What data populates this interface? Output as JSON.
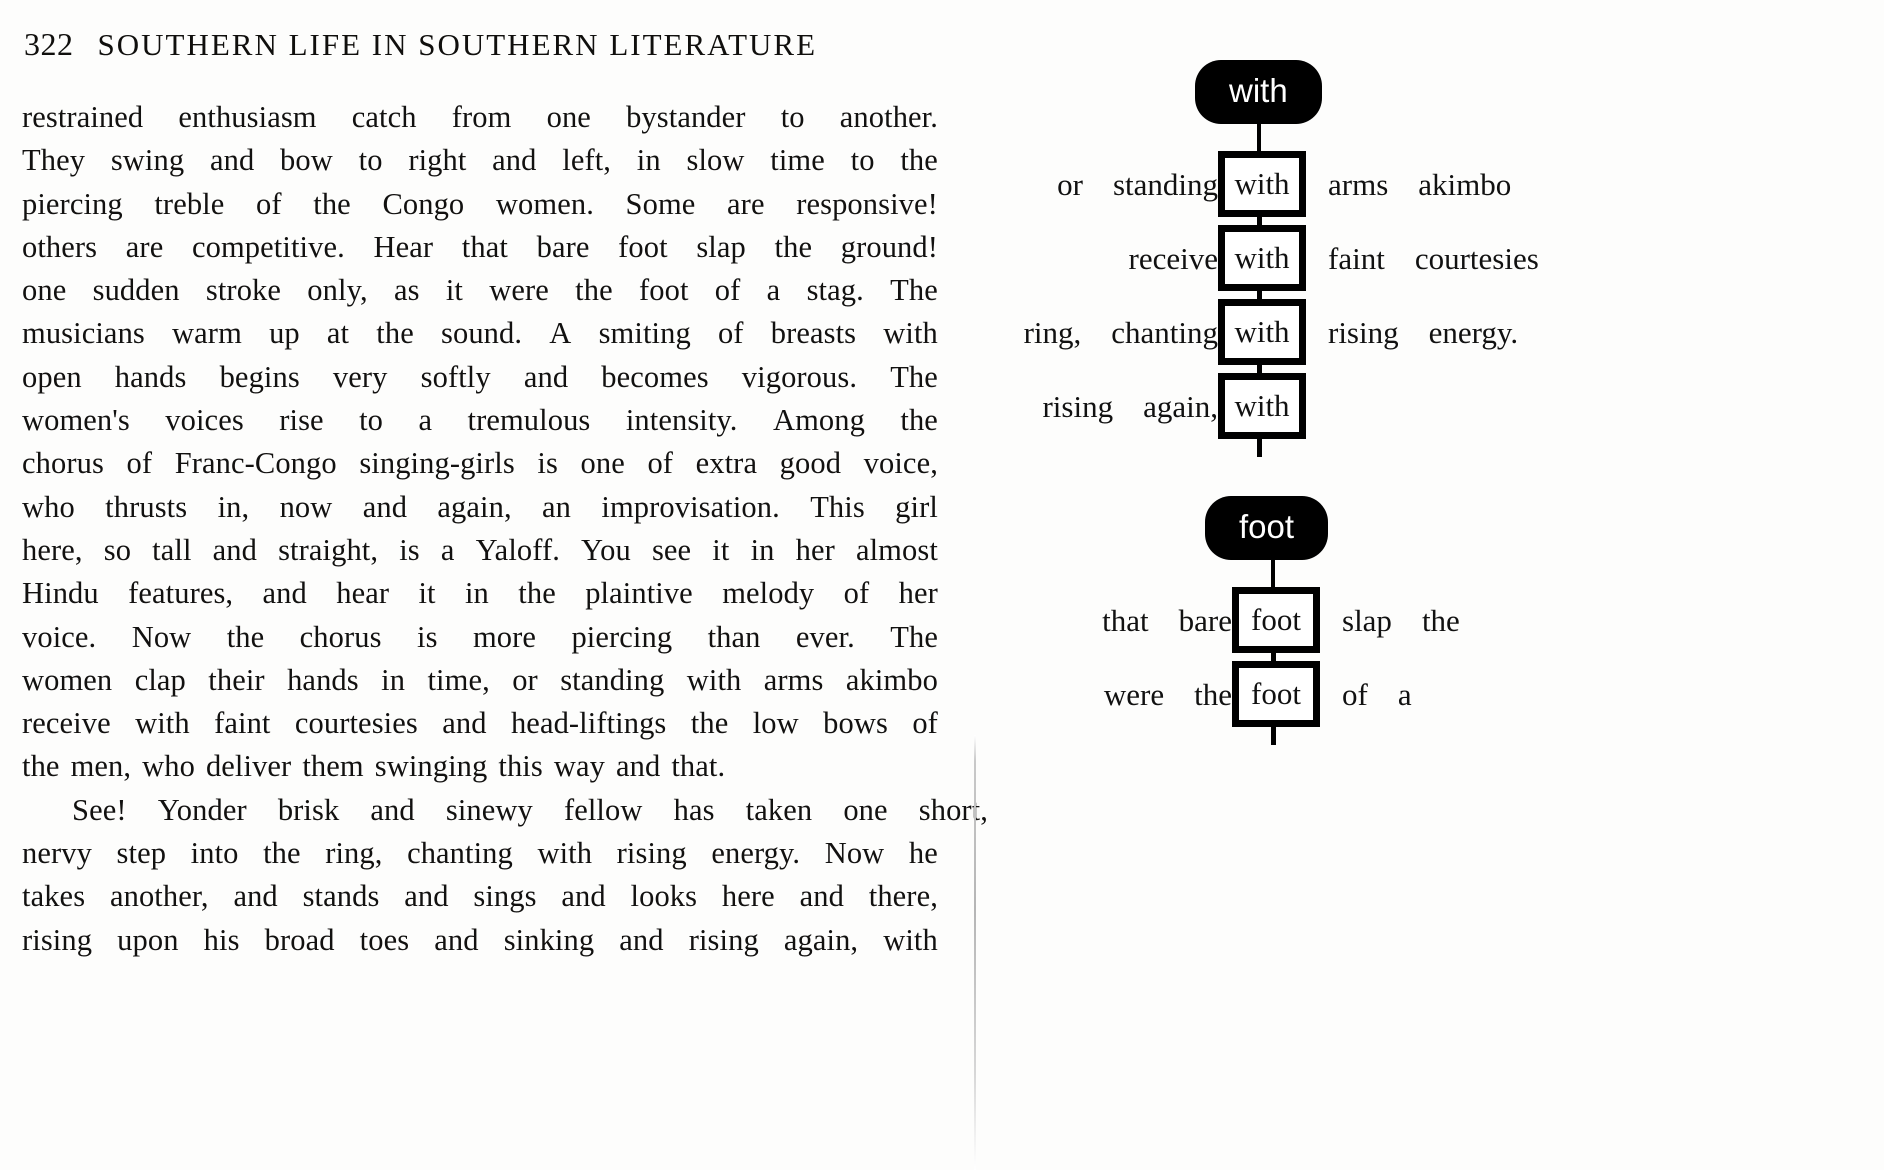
{
  "page": {
    "folio": "322",
    "running_head": "SOUTHERN LIFE IN SOUTHERN LITERATURE"
  },
  "body_lines": [
    {
      "words": [
        "restrained",
        "enthusiasm",
        "catch",
        "from",
        "one",
        "bystander",
        "to",
        "another."
      ],
      "justify": true
    },
    {
      "words": [
        "They",
        "swing",
        "and",
        "bow",
        "to",
        "right",
        "and",
        "left,",
        "in",
        "slow",
        "time",
        "to",
        "the"
      ],
      "justify": true
    },
    {
      "words": [
        "piercing",
        "treble",
        "of",
        "the",
        "Congo",
        "women.",
        "Some",
        "are",
        "responsive!"
      ],
      "justify": true
    },
    {
      "words": [
        "others",
        "are",
        "competitive.",
        "Hear",
        "that",
        "bare",
        "foot",
        "slap",
        "the",
        "ground!"
      ],
      "justify": true
    },
    {
      "words": [
        "one",
        "sudden",
        "stroke",
        "only,",
        "as",
        "it",
        "were",
        "the",
        "foot",
        "of",
        "a",
        "stag.",
        "The"
      ],
      "justify": true
    },
    {
      "words": [
        "musicians",
        "warm",
        "up",
        "at",
        "the",
        "sound.",
        "A",
        "smiting",
        "of",
        "breasts",
        "with"
      ],
      "justify": true
    },
    {
      "words": [
        "open",
        "hands",
        "begins",
        "very",
        "softly",
        "and",
        "becomes",
        "vigorous.",
        "The"
      ],
      "justify": true
    },
    {
      "words": [
        "women's",
        "voices",
        "rise",
        "to",
        "a",
        "tremulous",
        "intensity.",
        "Among",
        "the"
      ],
      "justify": true
    },
    {
      "words": [
        "chorus",
        "of",
        "Franc-Congo",
        "singing-girls",
        "is",
        "one",
        "of",
        "extra",
        "good",
        "voice,"
      ],
      "justify": true
    },
    {
      "words": [
        "who",
        "thrusts",
        "in,",
        "now",
        "and",
        "again,",
        "an",
        "improvisation.",
        "This",
        "girl"
      ],
      "justify": true
    },
    {
      "words": [
        "here,",
        "so",
        "tall",
        "and",
        "straight,",
        "is",
        "a",
        "Yaloff.",
        "You",
        "see",
        "it",
        "in",
        "her",
        "almost"
      ],
      "justify": true
    },
    {
      "words": [
        "Hindu",
        "features,",
        "and",
        "hear",
        "it",
        "in",
        "the",
        "plaintive",
        "melody",
        "of",
        "her"
      ],
      "justify": true
    },
    {
      "words": [
        "voice.",
        "Now",
        "the",
        "chorus",
        "is",
        "more",
        "piercing",
        "than",
        "ever.",
        "The"
      ],
      "justify": true
    },
    {
      "words": [
        "women",
        "clap",
        "their",
        "hands",
        "in",
        "time,",
        "or",
        "standing",
        "with",
        "arms",
        "akimbo"
      ],
      "justify": true
    },
    {
      "words": [
        "receive",
        "with",
        "faint",
        "courtesies",
        "and",
        "head-liftings",
        "the",
        "low",
        "bows",
        "of"
      ],
      "justify": true
    },
    {
      "words": [
        "the",
        "men,",
        "who",
        "deliver",
        "them",
        "swinging",
        "this",
        "way",
        "and",
        "that."
      ],
      "justify": false
    },
    {
      "words": [
        "See!",
        "Yonder",
        "brisk",
        "and",
        "sinewy",
        "fellow",
        "has",
        "taken",
        "one",
        "short,"
      ],
      "justify": true,
      "indent": true
    },
    {
      "words": [
        "nervy",
        "step",
        "into",
        "the",
        "ring,",
        "chanting",
        "with",
        "rising",
        "energy.",
        "Now",
        "he"
      ],
      "justify": true
    },
    {
      "words": [
        "takes",
        "another,",
        "and",
        "stands",
        "and",
        "sings",
        "and",
        "looks",
        "here",
        "and",
        "there,"
      ],
      "justify": true
    },
    {
      "words": [
        "rising",
        "upon",
        "his",
        "broad",
        "toes",
        "and",
        "sinking",
        "and",
        "rising",
        "again,",
        "with"
      ],
      "justify": true
    }
  ],
  "concordance": {
    "groups": [
      {
        "id": "with",
        "keyword": "with",
        "pill_label": "with",
        "rows": [
          {
            "left": [
              "or",
              "standing"
            ],
            "key": "with",
            "right": [
              "arms",
              "akimbo"
            ]
          },
          {
            "left": [
              "receive"
            ],
            "key": "with",
            "right": [
              "faint",
              "courtesies"
            ]
          },
          {
            "left": [
              "ring,",
              "chanting"
            ],
            "key": "with",
            "right": [
              "rising",
              "energy."
            ]
          },
          {
            "left": [
              "rising",
              "again,"
            ],
            "key": "with",
            "right": []
          }
        ]
      },
      {
        "id": "foot",
        "keyword": "foot",
        "pill_label": "foot",
        "rows": [
          {
            "left": [
              "that",
              "bare"
            ],
            "key": "foot",
            "right": [
              "slap",
              "the"
            ]
          },
          {
            "left": [
              "were",
              "the"
            ],
            "key": "foot",
            "right": [
              "of",
              "a"
            ]
          }
        ]
      }
    ]
  },
  "colors": {
    "pill_background": "#000000",
    "pill_text": "#ffffff",
    "box_border": "#000000",
    "box_background": "#ffffff",
    "page_background": "#ffffff",
    "ink": "#111111"
  }
}
